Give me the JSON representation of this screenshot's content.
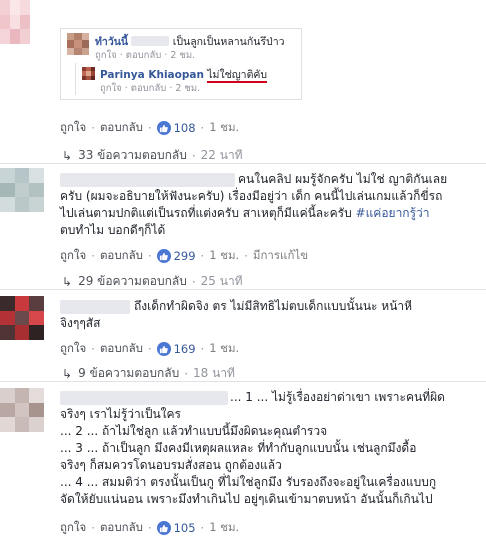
{
  "c0": {
    "quote_box": {
      "top_name_prefix": "ทำวันนี้",
      "top_text": "เป็นลูกเป็นหลานกันรึป่าว",
      "reply_name": "Parinya Khiaopan",
      "reply_text": "ไม่ใช่ญาติคับ",
      "reply_actions": [
        "ถูกใจ",
        "ตอบกลับ",
        "2 ชม."
      ],
      "top_actions": [
        "ถูกใจ",
        "ตอบกลับ",
        "2 ชม."
      ]
    },
    "actions": {
      "like": "ถูกใจ",
      "reply": "ตอบกลับ",
      "likes": "108",
      "time": "1 ชม."
    },
    "replies": "33 ข้อความตอบกลับ",
    "replies_time": "22 นาที"
  },
  "c1": {
    "lines": [
      "คนในคลิป ผมรู้จักครับ ไม่ใช่ ญาติกันเลย",
      "ครับ (ผมจะอธิบายให้ฟังนะครับ) เรื่องมีอยู่ว่า เด็ก คนนี้ไปเล่นเกมแล้วก็ขี่รถ",
      "ไปเล่นตามปกติแต่เป็นรถที่แต่งครับ สาเหตุก็มีแค่นี้ละครับ",
      "ตบทำไม บอกดีๆก็ได้"
    ],
    "hashtag": "#แค่อยากรู้ว่า",
    "actions": {
      "like": "ถูกใจ",
      "reply": "ตอบกลับ",
      "likes": "299",
      "time": "1 ชม.",
      "edited": "มีการแก้ไข"
    },
    "replies": "29 ข้อความตอบกลับ",
    "replies_time": "25 นาที"
  },
  "c2": {
    "lines": [
      "ถึงเด็กทำผิดจิง ตร ไม่มีสิทธิไม่ตบเด็กแบบนั้นนะ หน้าหี",
      "จิงๆๆสัส"
    ],
    "actions": {
      "like": "ถูกใจ",
      "reply": "ตอบกลับ",
      "likes": "169",
      "time": "1 ชม."
    },
    "replies": "9 ข้อความตอบกลับ",
    "replies_time": "18 นาที"
  },
  "c3": {
    "lines": [
      "... 1 ... ไม่รู้เรื่องอย่าด่าเขา เพราะคนที่ผิด",
      "จริงๆ เราไม่รู้ว่าเป็นใคร",
      "... 2 ... ถ้าไม่ใช่ลูก แล้วทำแบบนี้มึงผิดนะคุณตำรวจ",
      "... 3 ... ถ้าเป็นลูก มึงคงมีเหตุผลแหละ ที่ทำกับลูกแบบนั้น เช่นลูกมึงดื้อ",
      "จริงๆ ก็สมควรโดนอบรมสั่งสอน ถูกต้องแล้ว",
      "... 4 ... สมมติว่า ตรงนั้นเป็นกู ที่ไม่ใช่ลูกมึง รับรองถึงจะอยู่ในเครื่องแบบกู",
      "จัดให้ยับแน่นอน เพราะมึงทำเกินไป อยู่ๆเดินเข้ามาตบหน้า อันนั้นก็เกินไป"
    ],
    "actions": {
      "like": "ถูกใจ",
      "reply": "ตอบกลับ",
      "likes": "105",
      "time": "1 ชม."
    }
  },
  "colors": {
    "link": "#365899",
    "meta": "#90949c",
    "like_icon": "#4a76d4",
    "red_underline": "#d0021b"
  },
  "icons": {
    "like": "thumbs-up-icon",
    "reply_arrow": "reply-arrow-icon"
  }
}
